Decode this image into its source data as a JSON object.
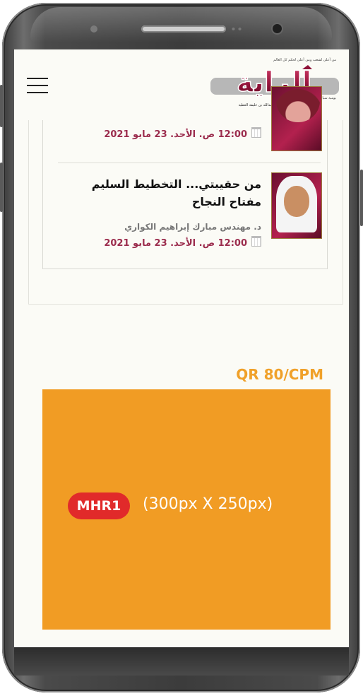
{
  "header": {
    "logo_tagline": "من أعلى لشعب ومن أعلى لحكم كل العالم",
    "logo_text": "الراية",
    "logo_sub": "يومية سياسية مستقلة",
    "logo_editor": "رئيس مجلس الإدارة: عبدالله بن خليفة العطية"
  },
  "articles": [
    {
      "date": "12:00 ص. الأحد. 23 مايو 2021"
    },
    {
      "title": "من حقيبتي... التخطيط السليم مفتاح النجاح",
      "author": "د. مهندس مبارك إبراهيم الكواري",
      "date": "12:00 ص. الأحد. 23 مايو 2021"
    }
  ],
  "ad": {
    "price": "QR 80/CPM",
    "slot": "MHR1",
    "size": "(300px X 250px)"
  },
  "colors": {
    "accent_date": "#9b2c4d",
    "ad_orange": "#f19c24",
    "ad_red": "#e12a2a"
  }
}
